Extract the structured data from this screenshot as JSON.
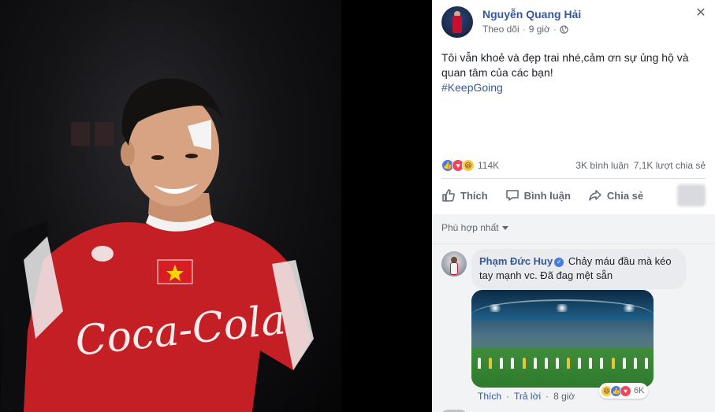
{
  "post": {
    "author": "Nguyễn Quang Hải",
    "follow_label": "Theo dõi",
    "time": "9 giờ",
    "text": "Tôi vẫn khoẻ và đẹp trai nhé,cảm ơn sự ủng hộ và quan tâm của các bạn!",
    "hashtag": "#KeepGoing",
    "reaction_count": "114K",
    "comments_count": "3K bình luận",
    "shares_count": "7,1K lượt chia sẻ"
  },
  "actions": {
    "like": "Thích",
    "comment": "Bình luận",
    "share": "Chia sẻ"
  },
  "comments_section": {
    "sort_label": "Phù hợp nhất",
    "comment": {
      "author": "Phạm Đức Huy",
      "text": "Chảy máu đầu mà kéo tay mạnh vc. Đã đag mệt sẵn",
      "like": "Thích",
      "reply": "Trả lời",
      "time": "8 giờ",
      "reaction_count": "6K"
    }
  },
  "colors": {
    "link": "#365899",
    "like_blue": "#4a7ce0",
    "love_red": "#f0455a",
    "haha_yellow": "#f8c94a"
  }
}
